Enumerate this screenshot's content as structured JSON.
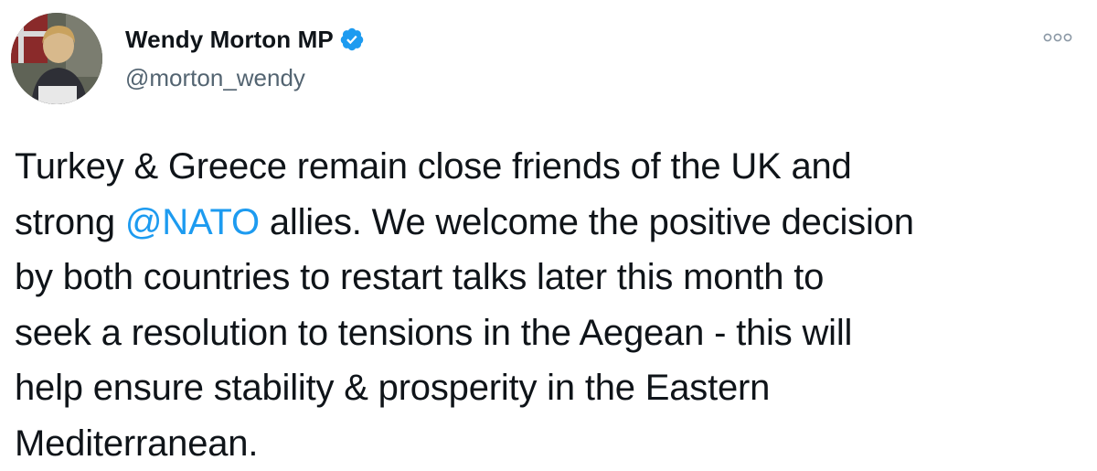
{
  "tweet": {
    "author": {
      "display_name": "Wendy Morton MP",
      "handle": "@morton_wendy",
      "verified": true,
      "avatar_icon": "profile-photo"
    },
    "more_icon": "ellipsis-icon",
    "text_lines": [
      {
        "before": "Turkey & Greece remain close friends of the UK and",
        "mention": "",
        "after": ""
      },
      {
        "before": "strong ",
        "mention": "@NATO",
        "after": " allies. We welcome the positive decision"
      },
      {
        "before": "by both countries to restart talks later this month to",
        "mention": "",
        "after": ""
      },
      {
        "before": "seek a resolution to tensions in the Aegean - this will",
        "mention": "",
        "after": ""
      },
      {
        "before": "help ensure stability & prosperity in the Eastern",
        "mention": "",
        "after": ""
      },
      {
        "before": "Mediterranean.",
        "mention": "",
        "after": ""
      }
    ]
  },
  "colors": {
    "text": "#0f1419",
    "secondary_text": "#536471",
    "link": "#1d9bf0",
    "verified_badge": "#1d9bf0"
  }
}
